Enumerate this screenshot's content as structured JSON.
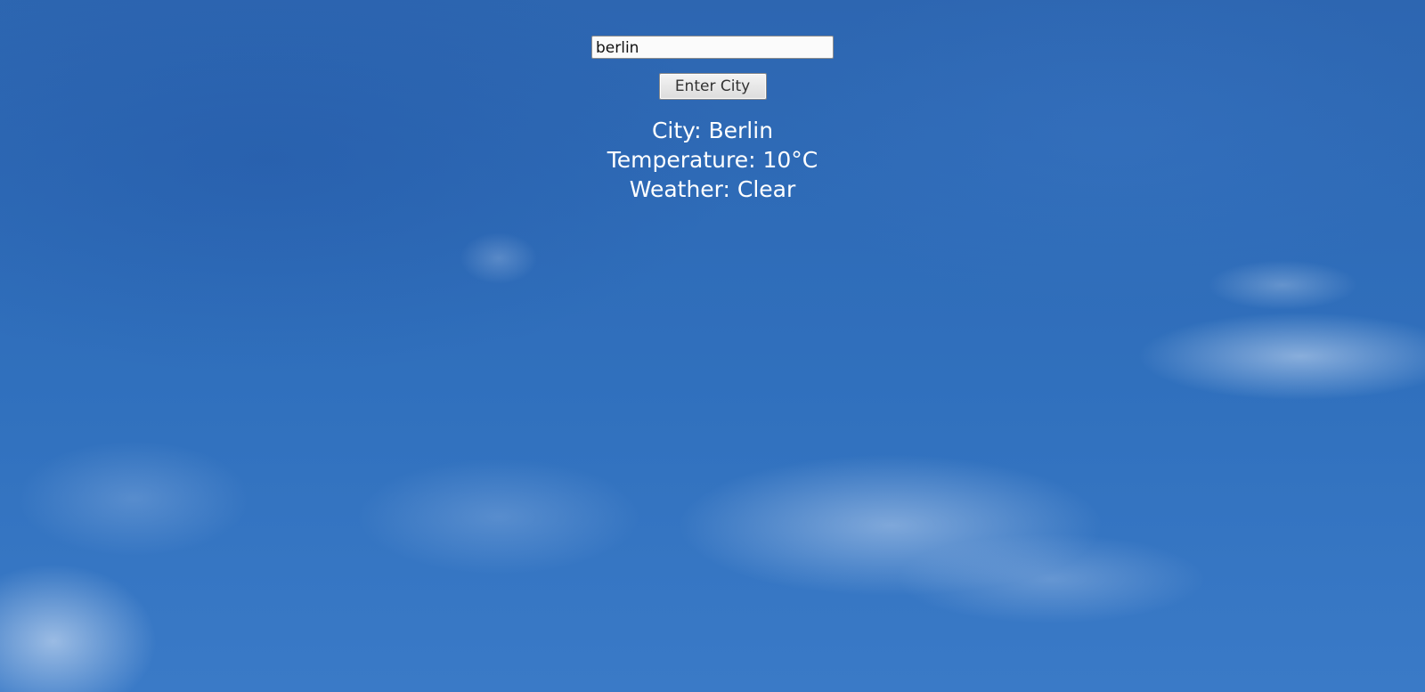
{
  "search": {
    "value": "berlin",
    "placeholder": ""
  },
  "actions": {
    "submit_label": "Enter City"
  },
  "weather": {
    "city_text": "City: Berlin",
    "temperature_text": "Temperature: 10°C",
    "condition_text": "Weather: Clear"
  },
  "theme": {
    "background": "sky-with-clouds",
    "text_color": "#ffffff",
    "sky_blue": "#2f67b3"
  }
}
